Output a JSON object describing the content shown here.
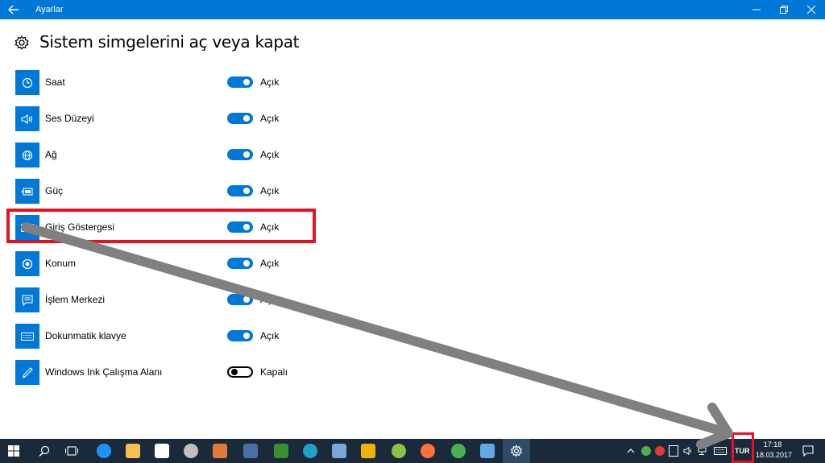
{
  "window": {
    "title": "Ayarlar"
  },
  "page": {
    "title": "Sistem simgelerini aç veya kapat"
  },
  "items": [
    {
      "label": "Saat",
      "state": "Açık",
      "on": true,
      "icon": "clock-icon"
    },
    {
      "label": "Ses Düzeyi",
      "state": "Açık",
      "on": true,
      "icon": "volume-icon"
    },
    {
      "label": "Ağ",
      "state": "Açık",
      "on": true,
      "icon": "globe-icon"
    },
    {
      "label": "Güç",
      "state": "Açık",
      "on": true,
      "icon": "battery-icon"
    },
    {
      "label": "Giriş Göstergesi",
      "state": "Açık",
      "on": true,
      "icon": "keyboard-icon"
    },
    {
      "label": "Konum",
      "state": "Açık",
      "on": true,
      "icon": "location-icon"
    },
    {
      "label": "İşlem Merkezi",
      "state": "Açık",
      "on": true,
      "icon": "action-center-icon"
    },
    {
      "label": "Dokunmatik klavye",
      "state": "Açık",
      "on": true,
      "icon": "keyboard-icon"
    },
    {
      "label": "Windows Ink Çalışma Alanı",
      "state": "Kapalı",
      "on": false,
      "icon": "pen-icon"
    }
  ],
  "taskbar": {
    "language": "TUR",
    "time": "17:18",
    "date": "18.03.2017"
  },
  "colors": {
    "accent": "#0078d7",
    "highlight": "#e81123",
    "taskbar": "#1b2a3a",
    "arrow": "#808080"
  }
}
